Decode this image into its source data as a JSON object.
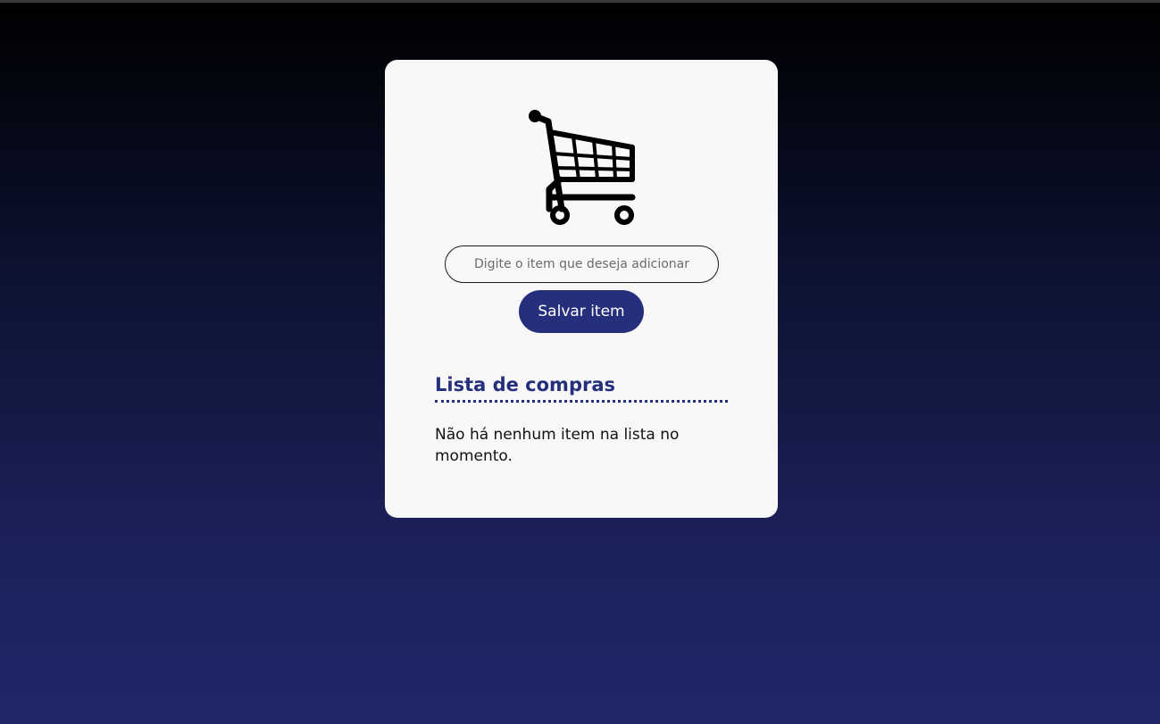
{
  "form": {
    "item_placeholder": "Digite o item que deseja adicionar",
    "item_value": "",
    "save_label": "Salvar item"
  },
  "list": {
    "title": "Lista de compras",
    "empty_message": "Não há nenhum item na lista no momento."
  },
  "icons": {
    "cart": "shopping-cart-icon"
  },
  "colors": {
    "accent": "#252f7c",
    "card_background": "#f8f8f8",
    "page_gradient_top": "#000000",
    "page_gradient_bottom": "#20276a"
  }
}
